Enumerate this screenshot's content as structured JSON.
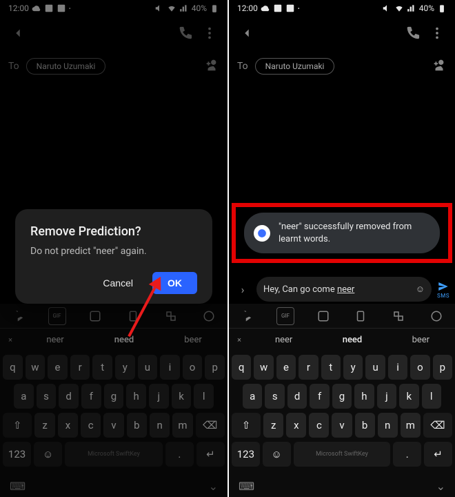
{
  "status": {
    "time": "12:00",
    "battery": "40%"
  },
  "composer": {
    "to": "To",
    "recipient": "Naruto Uzumaki"
  },
  "dialog": {
    "title": "Remove Prediction?",
    "message": "Do not predict \"neer\" again.",
    "cancel": "Cancel",
    "ok": "OK"
  },
  "snackbar": {
    "text": "\"neer\" successfully removed from learnt words."
  },
  "compose": {
    "body": "Hey, Can go come ",
    "underlined": "neer",
    "send_label": "SMS"
  },
  "suggestions": {
    "del": "×",
    "s1": "neer",
    "s2": "need",
    "s3": "beer"
  },
  "keyboard": {
    "row1": [
      "q",
      "w",
      "e",
      "r",
      "t",
      "y",
      "u",
      "i",
      "o",
      "p"
    ],
    "row2": [
      "a",
      "s",
      "d",
      "f",
      "g",
      "h",
      "j",
      "k",
      "l"
    ],
    "row3_shift": "⇧",
    "row3": [
      "z",
      "x",
      "c",
      "v",
      "b",
      "n",
      "m"
    ],
    "row3_back": "⌫",
    "numKey": "123",
    "space": "Microsoft SwiftKey",
    "enter": "↵"
  }
}
